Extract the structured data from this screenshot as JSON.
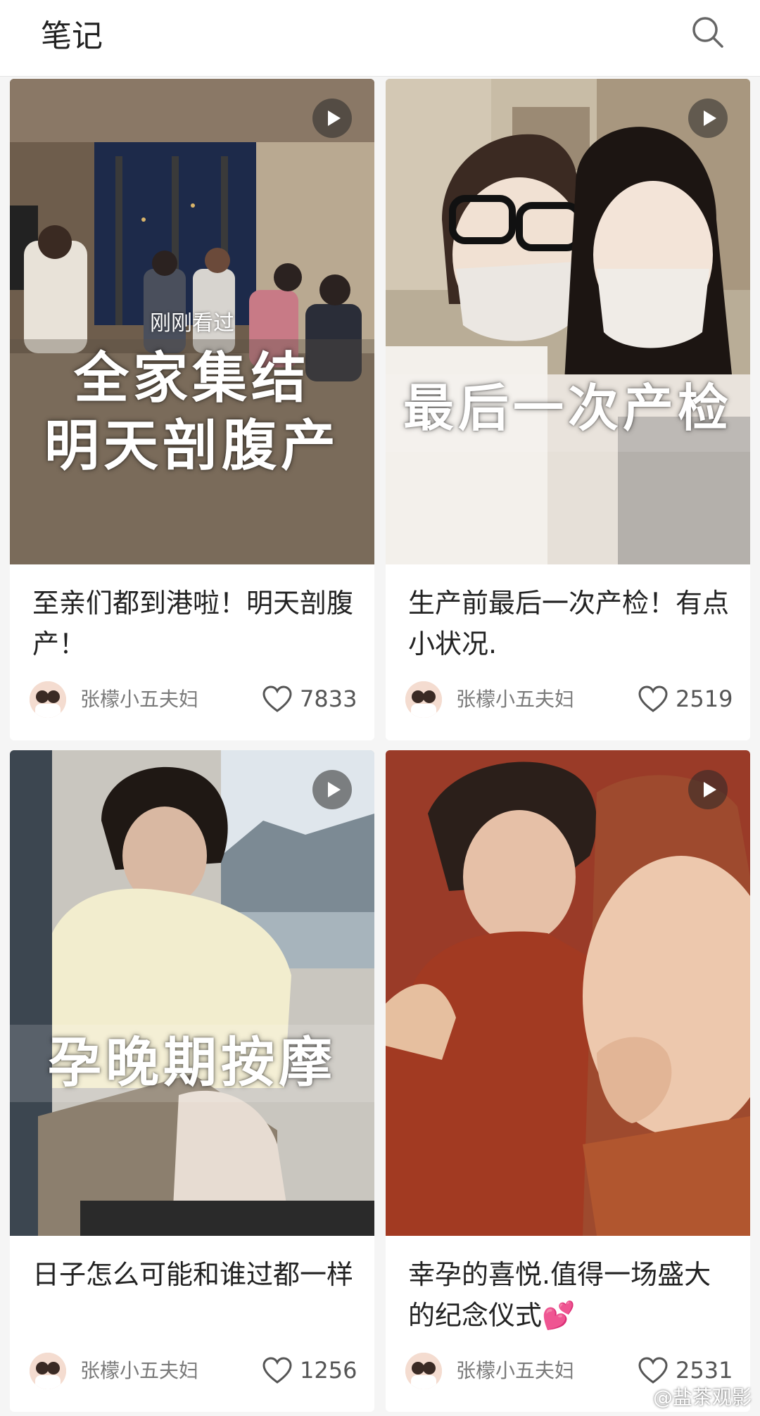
{
  "header": {
    "title": "笔记",
    "search_icon": "search-icon"
  },
  "cards": [
    {
      "overlay_lines": [
        "全家集结",
        "明天剖腹产"
      ],
      "recent_tag": "刚刚看过",
      "title": "至亲们都到港啦！明天剖腹产！",
      "author": "张檬小五夫妇",
      "likes": "7833"
    },
    {
      "overlay_lines": [
        "最后一次产检"
      ],
      "title": "生产前最后一次产检！有点小状况.",
      "author": "张檬小五夫妇",
      "likes": "2519"
    },
    {
      "overlay_lines": [
        "孕晚期按摩"
      ],
      "title": "日子怎么可能和谁过都一样",
      "author": "张檬小五夫妇",
      "likes": "1256"
    },
    {
      "overlay_lines": [],
      "title": "幸孕的喜悦.值得一场盛大的纪念仪式💕",
      "author": "张檬小五夫妇",
      "likes": "2531"
    }
  ],
  "watermark": "@盐茶观影",
  "colors": {
    "background": "#f5f5f5",
    "card": "#ffffff",
    "text": "#222222",
    "meta": "#7a7a7a"
  }
}
